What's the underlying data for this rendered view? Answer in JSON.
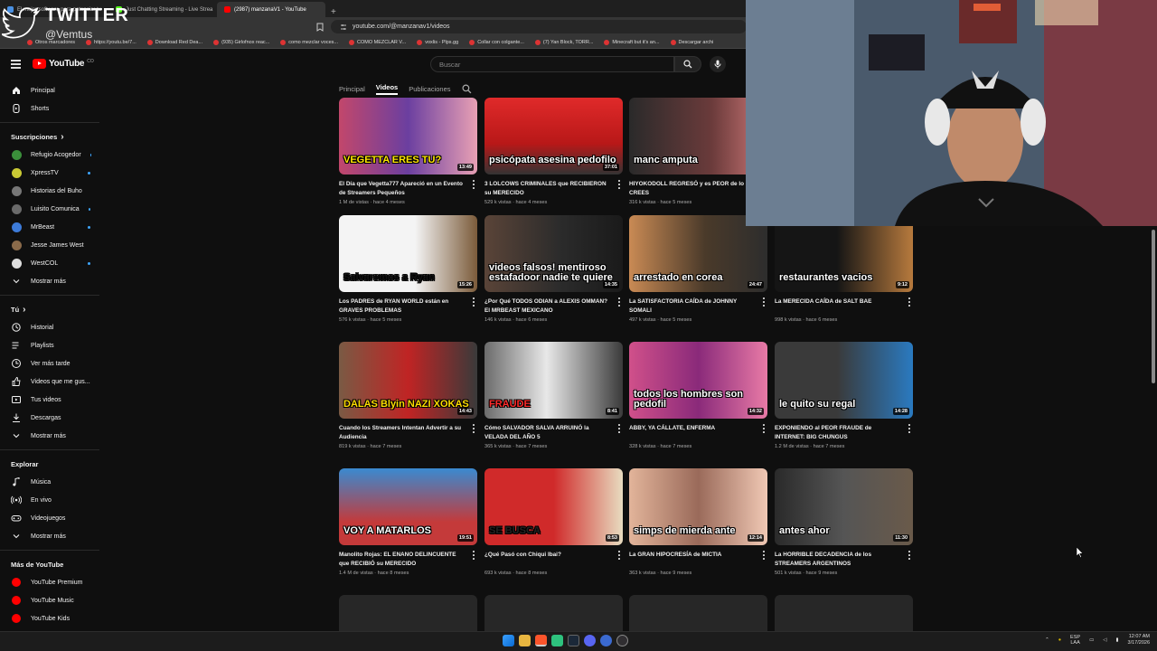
{
  "browser": {
    "tabs": [
      {
        "label": "El mejor software para potenciar tu",
        "color": "#4a90e2"
      },
      {
        "label": "Just Chatting Streaming - Live Strea",
        "color": "#53fc18"
      },
      {
        "label": "(2987) manzanaV1 - YouTube",
        "color": "#ff0000"
      }
    ],
    "url": "youtube.com/@manzanav1/videos",
    "bookmarks": [
      "Otros marcadores",
      "https://youtu.be/7...",
      "Download Red Dea...",
      "(935) Girlofnox reac...",
      "como mezclar voces...",
      "COMO MEZCLAR V...",
      "voxlis - Plps.gg",
      "Collar con colgante...",
      "(7) Yan Block, TORR...",
      "Minecraft but it's an...",
      "Descargar archi"
    ]
  },
  "watermark": {
    "platform": "TWITTER",
    "handle": "@Vemtus"
  },
  "header": {
    "logo": "YouTube",
    "country": "CO",
    "search_placeholder": "Buscar"
  },
  "sidebar": {
    "main": [
      {
        "label": "Principal",
        "icon": "home-icon"
      },
      {
        "label": "Shorts",
        "icon": "shorts-icon"
      }
    ],
    "subs_title": "Suscripciones",
    "subs": [
      {
        "label": "Refugio Acogedor",
        "color": "#3b8f3b",
        "dot": true
      },
      {
        "label": "XpressTV",
        "color": "#c9c934",
        "dot": true
      },
      {
        "label": "Historias del Buho",
        "color": "#777",
        "dot": false
      },
      {
        "label": "Luisito Comunica",
        "color": "#6a6a6a",
        "dot": true
      },
      {
        "label": "MrBeast",
        "color": "#3d7bd9",
        "dot": true
      },
      {
        "label": "Jesse James West",
        "color": "#8a6a4a",
        "dot": false
      },
      {
        "label": "WestCOL",
        "color": "#dddddd",
        "dot": true
      }
    ],
    "more": "Mostrar más",
    "you_title": "Tú",
    "you": [
      {
        "label": "Historial",
        "icon": "history-icon"
      },
      {
        "label": "Playlists",
        "icon": "playlist-icon"
      },
      {
        "label": "Ver más tarde",
        "icon": "clock-icon"
      },
      {
        "label": "Videos que me gus...",
        "icon": "like-icon"
      },
      {
        "label": "Tus videos",
        "icon": "video-icon"
      },
      {
        "label": "Descargas",
        "icon": "download-icon"
      }
    ],
    "explore_title": "Explorar",
    "explore": [
      {
        "label": "Música",
        "icon": "music-icon"
      },
      {
        "label": "En vivo",
        "icon": "live-icon"
      },
      {
        "label": "Videojuegos",
        "icon": "gaming-icon"
      }
    ],
    "more_yt_title": "Más de YouTube",
    "more_yt": [
      "YouTube Premium",
      "YouTube Music",
      "YouTube Kids"
    ]
  },
  "channel_tabs": {
    "principal": "Principal",
    "videos": "Videos",
    "publicaciones": "Publicaciones"
  },
  "videos": [
    {
      "title": "El Día que Vegetta777 Apareció en un Evento de Streamers Pequeños",
      "meta": "1 M de vistas · hace 4 meses",
      "dur": "13:49",
      "cap": "VEGETTA ERES TU?",
      "bg": "linear-gradient(90deg,#c2476b,#6b3fa0 50%,#e8a0b4)",
      "capcolor": "#ffe600"
    },
    {
      "title": "3 LOLCOWS CRIMINALES que RECIBIERON su MERECIDO",
      "meta": "529 k vistas · hace 4 meses",
      "dur": "37:01",
      "cap": "psicópata asesina pedofilo",
      "bg": "linear-gradient(180deg,#e02a2a,#b81818 60%,#333)",
      "capcolor": "#fff"
    },
    {
      "title": "HIYOKODOLL REGRESÓ y es PEOR de lo que CREES",
      "meta": "316 k vistas · hace 5 meses",
      "dur": "",
      "cap": "manc amputa",
      "bg": "linear-gradient(90deg,#2a2a2a,#6b3b3b 60%,#c77)",
      "capcolor": "#fff"
    },
    {
      "title": "Los PADRES de RYAN WORLD están en GRAVES PROBLEMAS",
      "meta": "576 k vistas · hace 5 meses",
      "dur": "15:26",
      "cap": "Salvaremos a Ryan",
      "bg": "linear-gradient(90deg,#f4f4f4 55%,#7b5b3a)",
      "capcolor": "#111"
    },
    {
      "title": "¿Por Qué TODOS ODIAN a ALEXIS OMMAN? El MRBEAST MEXICANO",
      "meta": "146 k vistas · hace 6 meses",
      "dur": "14:35",
      "cap": "videos falsos! mentiroso estafadoor nadie te quiere",
      "bg": "linear-gradient(90deg,#5a4438,#2b2b2b 55%,#1a1a1a)",
      "capcolor": "#fff"
    },
    {
      "title": "La SATISFACTORIA CAÍDA de JOHNNY SOMALI",
      "meta": "497 k vistas · hace 5 meses",
      "dur": "24:47",
      "cap": "arrestado en corea",
      "bg": "linear-gradient(90deg,#c98a54,#4a3a2a 55%,#2d2d2d)",
      "capcolor": "#fff"
    },
    {
      "title": "La MERECIDA CAÍDA de SALT BAE",
      "meta": "998 k vistas · hace 6 meses",
      "dur": "9:12",
      "cap": "restaurantes vacios",
      "bg": "linear-gradient(90deg,#151515 45%,#b77a3d)",
      "capcolor": "#fff"
    },
    {
      "title": "Cuando los Streamers Intentan Advertir a su Audiencia",
      "meta": "819 k vistas · hace 7 meses",
      "dur": "14:43",
      "cap": "DALAS Blyin NAZI XOKAS",
      "bg": "linear-gradient(90deg,#7a5a44,#c02424 50%,#3a3a3a)",
      "capcolor": "#ffdd00"
    },
    {
      "title": "Cómo SALVADOR SALVA ARRUINÓ la VELADA DEL AÑO 5",
      "meta": "365 k vistas · hace 7 meses",
      "dur": "8:41",
      "cap": "FRAUDE",
      "bg": "linear-gradient(90deg,#6b6b6b,#e8e8e8 45%,#3b3b3b)",
      "capcolor": "#ff2a2a"
    },
    {
      "title": "ABBY, YA CÁLLATE, ENFERMA",
      "meta": "328 k vistas · hace 7 meses",
      "dur": "14:32",
      "cap": "todos los hombres son pedofil",
      "bg": "linear-gradient(90deg,#d0508a,#8a2a7a 50%,#e87aa6)",
      "capcolor": "#fff"
    },
    {
      "title": "EXPONIENDO al PEOR FRAUDE de INTERNET: BIG CHUNGUS",
      "meta": "1.2 M de vistas · hace 7 meses",
      "dur": "14:28",
      "cap": "le quito su regal",
      "bg": "linear-gradient(90deg,#3a3a3a 45%,#2a7ac0)",
      "capcolor": "#fff"
    },
    {
      "title": "Manolito Rojas: EL ENANO DELINCUENTE que RECIBIÓ su MERECIDO",
      "meta": "1.4 M de vistas · hace 8 meses",
      "dur": "19:51",
      "cap": "VOY A MATARLOS",
      "bg": "linear-gradient(180deg,#3a8ad0,#c43a3a 70%)",
      "capcolor": "#fff"
    },
    {
      "title": "¿Qué Pasó con Chiqui Ibai?",
      "meta": "693 k vistas · hace 8 meses",
      "dur": "8:53",
      "cap": "SE BUSCA",
      "bg": "linear-gradient(90deg,#d02a2a 50%,#e8dcc0)",
      "capcolor": "#222"
    },
    {
      "title": "La GRAN HIPOCRESÍA de MICTIA",
      "meta": "363 k vistas · hace 9 meses",
      "dur": "12:14",
      "cap": "simps de mierda ante",
      "bg": "linear-gradient(90deg,#e2b49a,#9a6a5a 50%,#f0c8b4)",
      "capcolor": "#fff"
    },
    {
      "title": "La HORRIBLE DECADENCIA de los STREAMERS ARGENTINOS",
      "meta": "501 k vistas · hace 9 meses",
      "dur": "11:30",
      "cap": "antes ahor",
      "bg": "linear-gradient(90deg,#2a2a2a,#555 50%,#6a5a4a)",
      "capcolor": "#fff"
    }
  ],
  "taskbar": {
    "lang": "ESP",
    "region": "LAA",
    "time": "12:07 AM",
    "date": "3/17/2026"
  }
}
